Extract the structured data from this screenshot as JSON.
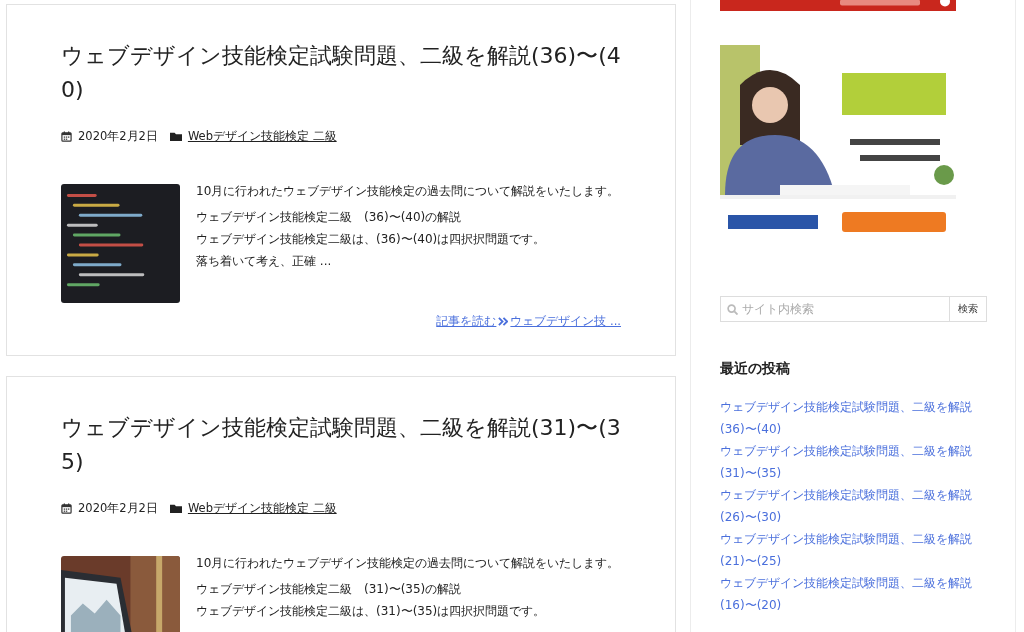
{
  "posts": [
    {
      "title": "ウェブデザイン技能検定試験問題、二級を解説(36)〜(40)",
      "date": "2020年2月2日",
      "category": "Webデザイン技能検定 二級",
      "thumbnail": {
        "kind": "picture"
      },
      "lead": "10月に行われたウェブデザイン技能検定の過去問について解説をいたします。",
      "excerpt_lines": [
        "ウェブデザイン技能検定二級　(36)〜(40)の解説",
        "ウェブデザイン技能検定二級は、(36)〜(40)は四択択問題です。",
        "落ち着いて考え、正確 ..."
      ],
      "read_more": "記事を読む",
      "read_more_title": "ウェブデザイン技 ..."
    },
    {
      "title": "ウェブデザイン技能検定試験問題、二級を解説(31)〜(35)",
      "date": "2020年2月2日",
      "category": "Webデザイン技能検定 二級",
      "thumbnail": {
        "kind": "picture"
      },
      "lead": "10月に行われたウェブデザイン技能検定の過去問について解説をいたします。",
      "excerpt_lines": [
        "ウェブデザイン技能検定二級　(31)〜(35)の解説",
        "ウェブデザイン技能検定二級は、(31)〜(35)は四択択問題です。"
      ]
    }
  ],
  "sidebar": {
    "banners": [
      {
        "kind": "picture"
      },
      {
        "kind": "picture"
      }
    ],
    "search": {
      "placeholder": "サイト内検索",
      "button": "検索"
    },
    "recent_heading": "最近の投稿",
    "recent_posts": [
      "ウェブデザイン技能検定試験問題、二級を解説(36)〜(40)",
      "ウェブデザイン技能検定試験問題、二級を解説(31)〜(35)",
      "ウェブデザイン技能検定試験問題、二級を解説(26)〜(30)",
      "ウェブデザイン技能検定試験問題、二級を解説(21)〜(25)",
      "ウェブデザイン技能検定試験問題、二級を解説(16)〜(20)"
    ]
  }
}
